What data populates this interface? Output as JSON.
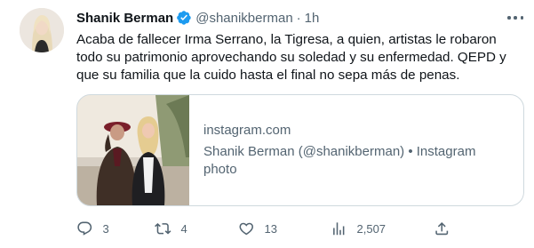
{
  "tweet": {
    "author_name": "Shanik Berman",
    "handle": "@shanikberman",
    "separator": "·",
    "time": "1h",
    "text": "Acaba de fallecer Irma Serrano, la Tigresa, a quien, artistas le robaron todo su patrimonio aprovechando su soledad y su enfermedad. QEPD y que su familia que la cuido hasta el final no sepa más de penas.",
    "verified_color": "#1d9bf0"
  },
  "card": {
    "domain": "instagram.com",
    "title": "Shanik Berman (@shanikberman) • Instagram photo"
  },
  "actions": {
    "replies": "3",
    "retweets": "4",
    "likes": "13",
    "views": "2,507"
  },
  "icons": {
    "verified": "verified-badge-icon",
    "more": "more-icon",
    "reply": "reply-icon",
    "retweet": "retweet-icon",
    "like": "heart-icon",
    "views": "views-chart-icon",
    "share": "share-icon"
  }
}
